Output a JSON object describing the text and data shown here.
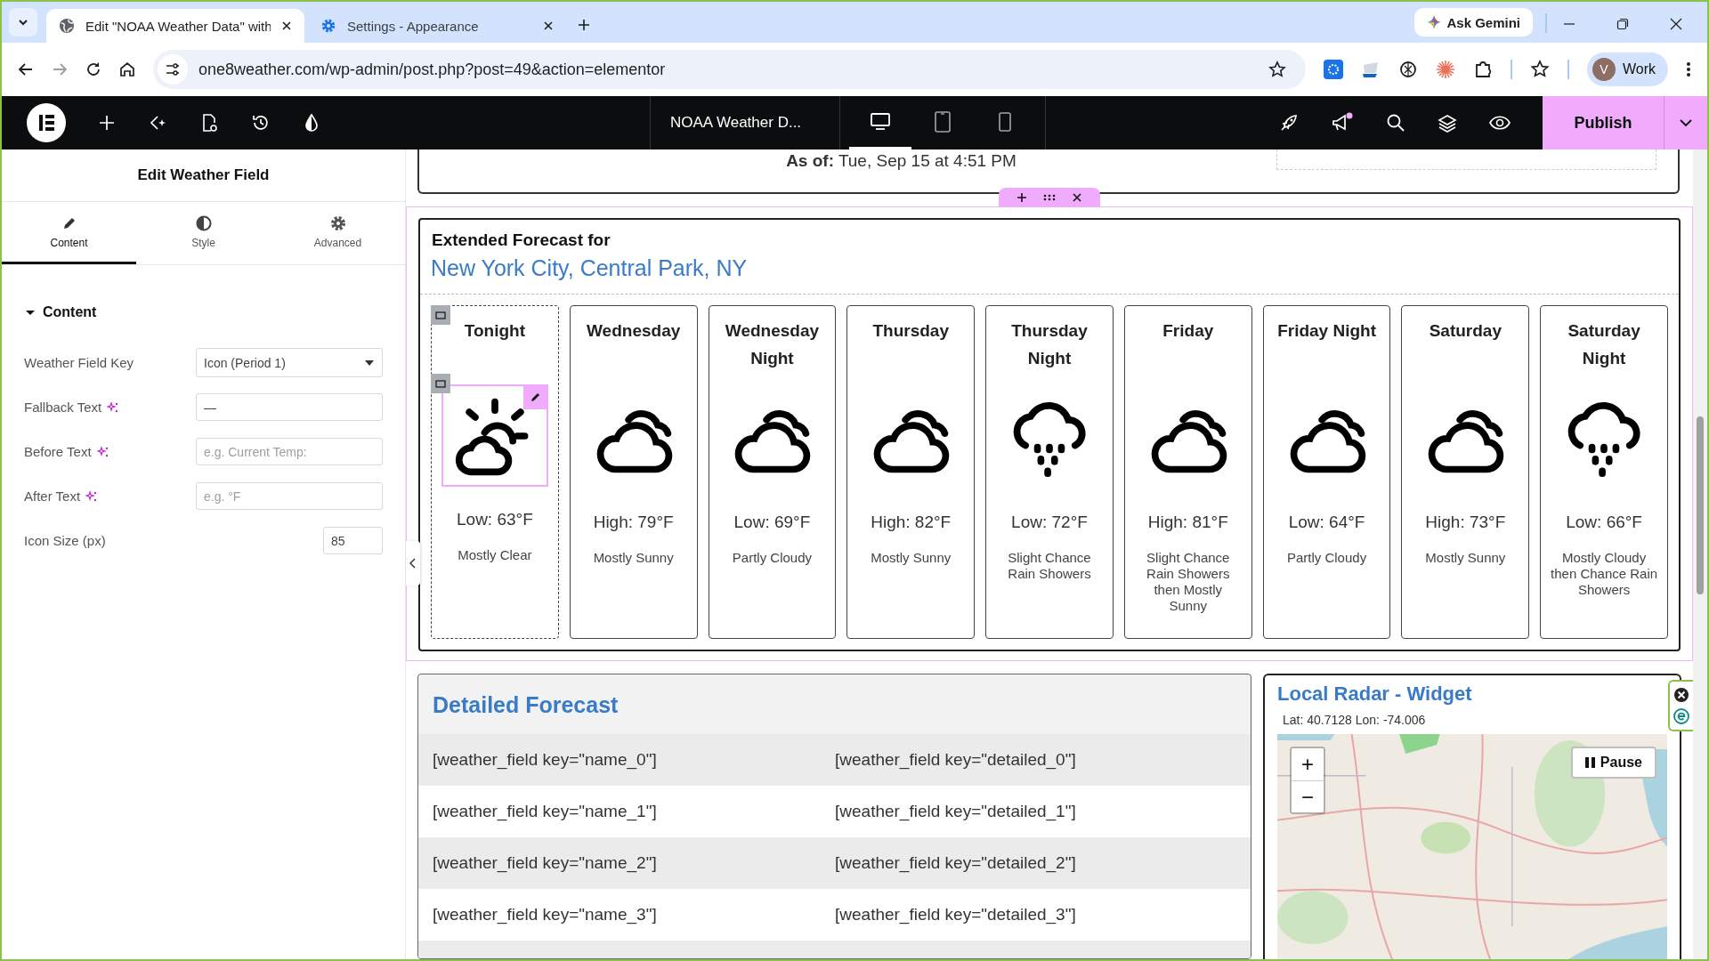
{
  "browser": {
    "tabs": [
      {
        "title": "Edit \"NOAA Weather Data\" with",
        "kind": "globe",
        "selected": true
      },
      {
        "title": "Settings - Appearance",
        "kind": "gear",
        "selected": false
      }
    ],
    "url": "one8weather.com/wp-admin/post.php?post=49&action=elementor",
    "assistant": "Ask Gemini",
    "profile_initial": "V",
    "profile": "Work"
  },
  "editor": {
    "document_title": "NOAA Weather D...",
    "devices": [
      {
        "kind": "desktop",
        "selected": true
      },
      {
        "kind": "tablet",
        "selected": false
      },
      {
        "kind": "mobile",
        "selected": false
      }
    ],
    "publish": "Publish"
  },
  "panel": {
    "title": "Edit Weather Field",
    "tabs": [
      {
        "label": "Content",
        "kind": "pencil",
        "selected": true
      },
      {
        "label": "Style",
        "kind": "contrast",
        "selected": false
      },
      {
        "label": "Advanced",
        "kind": "gear",
        "selected": false
      }
    ],
    "section": {
      "label": "Content",
      "expanded": true
    },
    "fields": [
      {
        "label": "Weather Field Key",
        "kind": "select",
        "value": "Icon (Period 1)",
        "ai": false
      },
      {
        "label": "Fallback Text",
        "kind": "text",
        "value": "—",
        "ai": true
      },
      {
        "label": "Before Text",
        "kind": "text",
        "placeholder": "e.g. Current Temp:",
        "ai": true
      },
      {
        "label": "After Text",
        "kind": "text",
        "placeholder": "e.g. °F",
        "ai": true
      },
      {
        "label": "Icon Size (px)",
        "kind": "number",
        "value": "85",
        "ai": false
      }
    ]
  },
  "canvas": {
    "as_of_label": "As of:",
    "as_of_value": "Tue, Sep 15 at 4:51 PM",
    "forecast": {
      "heading": "Extended Forecast for",
      "location": "New York City, Central Park, NY",
      "periods": [
        {
          "name": "Tonight",
          "kind": "sun-cloud",
          "temp": "Low: 63°F",
          "summary": "Mostly Clear",
          "selected": true
        },
        {
          "name": "Wednesday",
          "kind": "cloud",
          "temp": "High: 79°F",
          "summary": "Mostly Sunny",
          "selected": false
        },
        {
          "name": "Wednesday Night",
          "kind": "cloud",
          "temp": "Low: 69°F",
          "summary": "Partly Cloudy",
          "selected": false
        },
        {
          "name": "Thursday",
          "kind": "cloud",
          "temp": "High: 82°F",
          "summary": "Mostly Sunny",
          "selected": false
        },
        {
          "name": "Thursday Night",
          "kind": "rain",
          "temp": "Low: 72°F",
          "summary": "Slight Chance Rain Showers",
          "selected": false
        },
        {
          "name": "Friday",
          "kind": "cloud",
          "temp": "High: 81°F",
          "summary": "Slight Chance Rain Showers then Mostly Sunny",
          "selected": false
        },
        {
          "name": "Friday Night",
          "kind": "cloud",
          "temp": "Low: 64°F",
          "summary": "Partly Cloudy",
          "selected": false
        },
        {
          "name": "Saturday",
          "kind": "cloud",
          "temp": "High: 73°F",
          "summary": "Mostly Sunny",
          "selected": false
        },
        {
          "name": "Saturday Night",
          "kind": "rain",
          "temp": "Low: 66°F",
          "summary": "Mostly Cloudy then Chance Rain Showers",
          "selected": false
        }
      ]
    },
    "detailed": {
      "title": "Detailed Forecast",
      "rows": [
        {
          "name": "[weather_field key=\"name_0\"]",
          "detail": "[weather_field key=\"detailed_0\"]"
        },
        {
          "name": "[weather_field key=\"name_1\"]",
          "detail": "[weather_field key=\"detailed_1\"]"
        },
        {
          "name": "[weather_field key=\"name_2\"]",
          "detail": "[weather_field key=\"detailed_2\"]"
        },
        {
          "name": "[weather_field key=\"name_3\"]",
          "detail": "[weather_field key=\"detailed_3\"]"
        }
      ]
    },
    "radar": {
      "title": "Local Radar - Widget",
      "coords": "Lat: 40.7128 Lon: -74.006",
      "zoom_in": "+",
      "zoom_out": "−",
      "pause": "Pause"
    }
  }
}
